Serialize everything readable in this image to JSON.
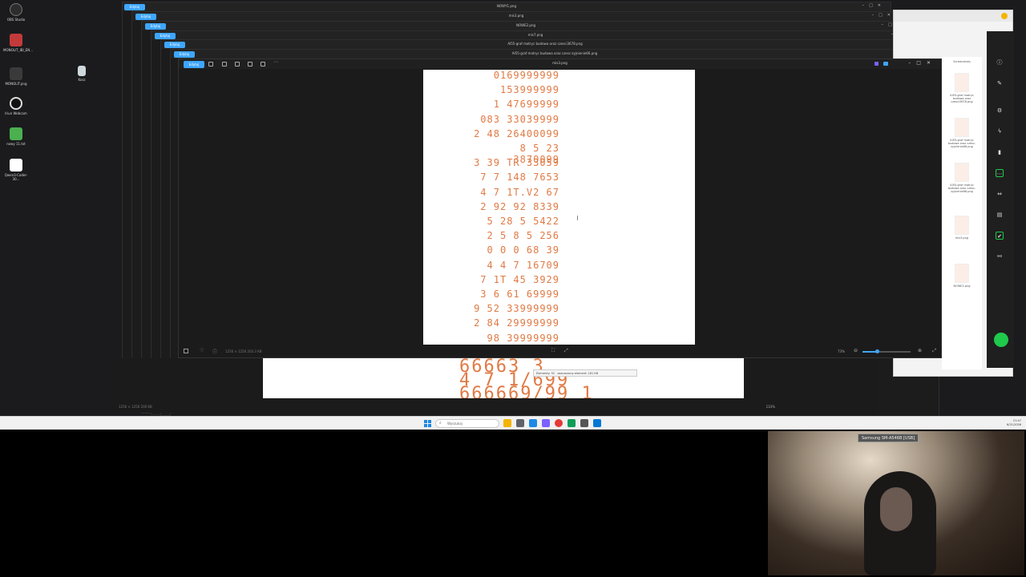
{
  "desktop": {
    "icons": [
      {
        "label": "OBS Studio",
        "color": "#2d2d2d"
      },
      {
        "label": "MONOLIT_IBI_EN...",
        "color": "#c33a3a"
      },
      {
        "label": "MONOLIT.png",
        "color": "#3a3a3a"
      },
      {
        "label": "Iriun Webcam",
        "color": "#1a1a1a"
      },
      {
        "label": "nowy 11.txt",
        "color": "#4caf50"
      },
      {
        "label": "Qwen3-Coder-30...",
        "color": "#ffffff"
      }
    ],
    "recycle_label": "Kosz"
  },
  "stacked_windows": [
    {
      "title": "NOWY1.png"
    },
    {
      "title": "mis3.png"
    },
    {
      "title": "NOWE2.png"
    },
    {
      "title": "mis7.png"
    },
    {
      "title": "AI55-graf matryc budowa oraz czesci3678.png"
    },
    {
      "title": "AI55-graf matryc budowa oraz czesc-zyjnienie66.png"
    }
  ],
  "front_window": {
    "title": "mis3.png",
    "tab_label": "Edytuj",
    "status_left": "1256 × 1256   203.3 KB",
    "zoom": "73%",
    "rows": [
      "0169999999",
      "153999999",
      "1  47699999",
      "083 33039999",
      "2 48 26400099",
      "8  5 23 3870099",
      "3  39 TR 33059",
      "7  7  148 7653",
      "4  7  1T.V2 67",
      "2  92  92 8339",
      "5  28  5  5422",
      "2  5  8  5  256",
      "0  0  0  68 39",
      "4  4  7  16709",
      "7  1T  45 3929",
      "3  6  61 69999",
      "9  52 33999999",
      "2  84 29999999",
      "98 39999999"
    ]
  },
  "back_window": {
    "big_line1": "66663 3",
    "big_line2": "4  7  1/699",
    "big_line3": "666669/99 1",
    "status_left": "1256 × 1256   200 KB",
    "zoom": "133%",
    "tooltip1": "Elementy: 52",
    "tooltip2": "zaznaczony element: 181 KB"
  },
  "browser": {
    "files": [
      {
        "label": "Screenshots"
      },
      {
        "label": "AI55-graf matryc budowa oraz czesci3678.png"
      },
      {
        "label": "AI55-graf matryc budowa oraz czesc-zyjnienie66.png"
      },
      {
        "label": "AI55-graf matryc budowa oraz czesc-zyjnienie66.png"
      },
      {
        "label": "mis3.png"
      },
      {
        "label": "NOWE2.png"
      }
    ]
  },
  "taskbar": {
    "search_placeholder": "Wyszukaj",
    "time": "21:47",
    "date": "6/21/2026",
    "apps": [
      {
        "color": "#f4b400"
      },
      {
        "color": "#5f6368"
      },
      {
        "color": "#1e88e5"
      },
      {
        "color": "#7b61ff"
      },
      {
        "color": "#e53935"
      },
      {
        "color": "#0f9d58"
      },
      {
        "color": "#555555"
      },
      {
        "color": "#f4b400"
      },
      {
        "color": "#0078d4"
      }
    ]
  },
  "webcam": {
    "device_label": "Samsung SM-A546B [USB]"
  }
}
